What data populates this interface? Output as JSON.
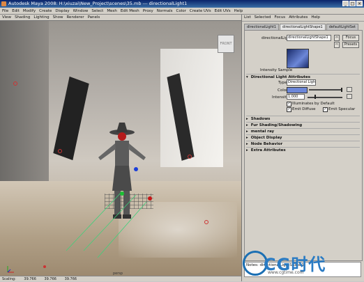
{
  "window": {
    "title": "Autodesk Maya 2008: H:\\xiuzai\\New_Project\\scenes\\35.mb  ---  directionalLight1",
    "controls": [
      "_",
      "□",
      "×"
    ]
  },
  "menubar": [
    "File",
    "Edit",
    "Modify",
    "Create",
    "Display",
    "Window",
    "Select",
    "Mesh",
    "Edit Mesh",
    "Proxy",
    "Normals",
    "Color",
    "Create UVs",
    "Edit UVs",
    "Help"
  ],
  "panel_menu": [
    "View",
    "Shading",
    "Lighting",
    "Show",
    "Renderer",
    "Panels"
  ],
  "viewport": {
    "camera_label": "persp",
    "viewcube_label": "FRONT"
  },
  "statusbar": {
    "scaling_label": "Scaling:",
    "values": [
      "39.766",
      "39.766",
      "39.766"
    ]
  },
  "attribute_editor": {
    "menu": [
      "List",
      "Selected",
      "Focus",
      "Attributes",
      "Help"
    ],
    "tabs": [
      "directionalLight1",
      "directionalLightShape1",
      "defaultLightSet"
    ],
    "active_tab": "directionalLightShape1",
    "node_label": "directionalLight:",
    "node_value": "directionalLightShape1",
    "focus_button": "Focus",
    "presets_button": "Presets",
    "sample_label": "Intensity Sample",
    "section_title": "Directional Light Attributes",
    "type_label": "Type",
    "type_value": "Directional Light",
    "color_label": "Color",
    "intensity_label": "Intensity",
    "intensity_value": "1.000",
    "illuminates_label": "Illuminates by Default",
    "emit_diffuse_label": "Emit Diffuse",
    "emit_specular_label": "Emit Specular",
    "collapsed_sections": [
      "Shadows",
      "Fur Shading/Shadowing",
      "mental ray",
      "Object Display",
      "Node Behavior",
      "Extra Attributes"
    ],
    "notes_label": "Notes:  directionalLightShape1"
  },
  "watermark": {
    "brand": "CG时代",
    "site": "www.cgtime.com"
  },
  "colors": {
    "title_bar": "#0a246a",
    "light_color_swatch": "#6c87d8",
    "watermark": "#2a7bc3"
  }
}
